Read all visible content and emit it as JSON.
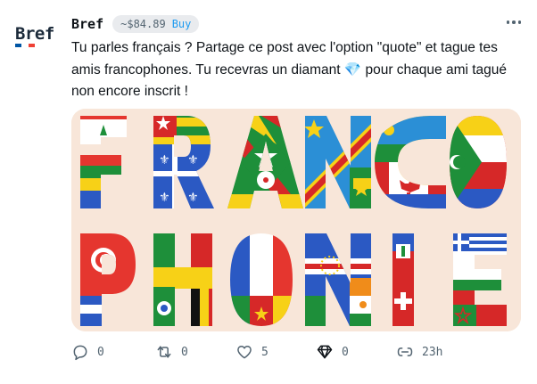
{
  "avatar": {
    "text": "Bref",
    "flag_colors": [
      "#0055a4",
      "#ffffff",
      "#ef4135"
    ]
  },
  "header": {
    "author": "Bref",
    "price": "~$84.89",
    "buy_label": "Buy"
  },
  "post": {
    "text_before_emoji": "Tu parles français ? Partage ce post avec l'option \"quote\" et tague tes amis francophones. Tu recevras un diamant ",
    "emoji": "💎",
    "text_after_emoji": " pour chaque ami tagué non encore inscrit !"
  },
  "media": {
    "description_icon": "francophonie-flags-image",
    "word_row1": [
      "F",
      "R",
      "A",
      "N",
      "C",
      "O"
    ],
    "word_row2": [
      "P",
      "H",
      "O",
      "N",
      "I",
      "E"
    ],
    "background": "#f8e6d9"
  },
  "actions": {
    "reply": {
      "icon": "reply-icon",
      "count": "0"
    },
    "repost": {
      "icon": "repost-icon",
      "count": "0"
    },
    "like": {
      "icon": "heart-icon",
      "count": "5"
    },
    "diamond": {
      "icon": "diamond-icon",
      "count": "0"
    },
    "views": {
      "icon": "views-icon",
      "count": "23h"
    }
  },
  "colors": {
    "buy": "#1d9bf0",
    "muted": "#536471",
    "text": "#0f1419"
  }
}
